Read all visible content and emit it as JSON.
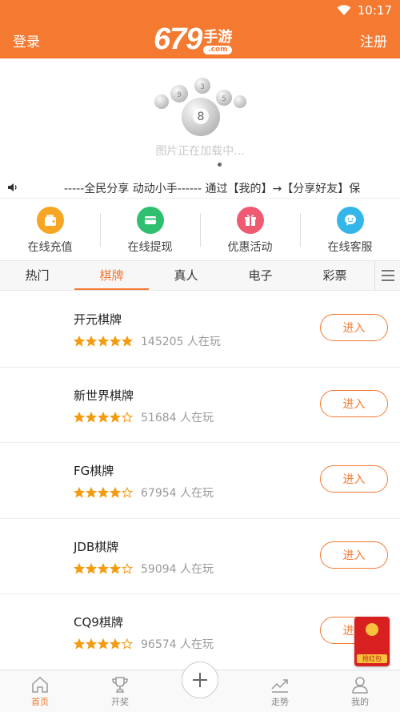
{
  "status": {
    "time": "10:17"
  },
  "header": {
    "login_label": "登录",
    "register_label": "注册",
    "logo_num": "679",
    "logo_cn": "手游",
    "logo_domain": ".com"
  },
  "banner": {
    "loading_text": "图片正在加载中..."
  },
  "marquee": {
    "text": "-----全民分享 动动小手------      通过【我的】→【分享好友】保"
  },
  "quick_actions": [
    {
      "label": "在线充值",
      "icon": "wallet-icon",
      "color": "#f6a623"
    },
    {
      "label": "在线提现",
      "icon": "card-icon",
      "color": "#2fbf71"
    },
    {
      "label": "优惠活动",
      "icon": "gift-icon",
      "color": "#ef5a72"
    },
    {
      "label": "在线客服",
      "icon": "chat-icon",
      "color": "#35b6e9"
    }
  ],
  "tabs": [
    {
      "label": "热门"
    },
    {
      "label": "棋牌",
      "active": true
    },
    {
      "label": "真人"
    },
    {
      "label": "电子"
    },
    {
      "label": "彩票"
    }
  ],
  "games": [
    {
      "name": "开元棋牌",
      "rating": 5,
      "count": "145205 人在玩",
      "button": "进入"
    },
    {
      "name": "新世界棋牌",
      "rating": 4,
      "count": "51684 人在玩",
      "button": "进入"
    },
    {
      "name": "FG棋牌",
      "rating": 4,
      "count": "67954 人在玩",
      "button": "进入"
    },
    {
      "name": "JDB棋牌",
      "rating": 4,
      "count": "59094 人在玩",
      "button": "进入"
    },
    {
      "name": "CQ9棋牌",
      "rating": 4,
      "count": "96574 人在玩",
      "button": "进入"
    }
  ],
  "bottom_nav": [
    {
      "label": "首页",
      "icon": "home-icon",
      "active": true
    },
    {
      "label": "开奖",
      "icon": "trophy-icon"
    },
    {
      "label": "",
      "icon": "plus-icon"
    },
    {
      "label": "走势",
      "icon": "trend-icon"
    },
    {
      "label": "我的",
      "icon": "user-icon"
    }
  ],
  "redpack": {
    "label": "抢红包"
  },
  "colors": {
    "accent": "#f47a32",
    "star": "#f39c12"
  }
}
